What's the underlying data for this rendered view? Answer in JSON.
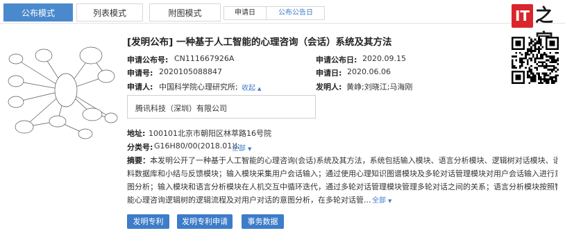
{
  "tabs": [
    {
      "label": "公布模式",
      "active": true
    },
    {
      "label": "列表模式",
      "active": false
    },
    {
      "label": "附图模式",
      "active": false
    }
  ],
  "sort": {
    "items": [
      "申请日",
      "公布公告日"
    ],
    "selected": "公布公告日"
  },
  "logo": {
    "it": "IT",
    "zh": "之家"
  },
  "drawing": {
    "icon": "patent-drawing-thumbnail"
  },
  "qr": {
    "icon": "qr-code"
  },
  "record": {
    "title": "[发明公布] 一种基于人工智能的心理咨询（会话）系统及其方法",
    "pub_no_label": "申请公布号:",
    "pub_no": "CN111667926A",
    "pub_date_label": "申请公布日:",
    "pub_date": "2020.09.15",
    "app_no_label": "申请号:",
    "app_no": "2020105088847",
    "app_date_label": "申请日:",
    "app_date": "2020.06.06",
    "applicant_label": "申请人:",
    "applicant": "中国科学院心理研究所;",
    "collapse": "收起",
    "inventor_label": "发明人:",
    "inventor": "黄峥;刘晓江;马海刚",
    "co_applicant": "腾讯科技（深圳）有限公司",
    "address_label": "地址:",
    "address": "100101北京市朝阳区林萃路16号院",
    "class_label": "分类号:",
    "class": "G16H80/00(2018.01)I;",
    "class_more": "全部",
    "abstract_label": "摘要：",
    "abstract_lines": [
      "本发明公开了一种基于人工智能的心理咨询(会话)系统及其方法，系统包括输入模块、语言分析模块、逻辑树对话模块、语",
      "料数据库和小结与反馈模块；输入模块采集用户会话输入；通过使用心理知识图谱模块及多轮对话管理模块对用户会话输入进行意",
      "图分析；输入模块和语言分析模块在人机交互中循环迭代，通过多轮对话管理模块管理多轮对话之间的关系；语言分析模块按照智",
      "能心理咨询逻辑树的逻辑流程及对用户对话的意图分析，在多轮对话管..."
    ],
    "abstract_more": "全部"
  },
  "buttons": {
    "invention_patent": "发明专利",
    "invention_application": "发明专利申请",
    "affairs_data": "事务数据"
  },
  "colors": {
    "accent": "#3d7cc9",
    "tab_active": "#4a89cc",
    "logo_red": "#d9252b"
  }
}
